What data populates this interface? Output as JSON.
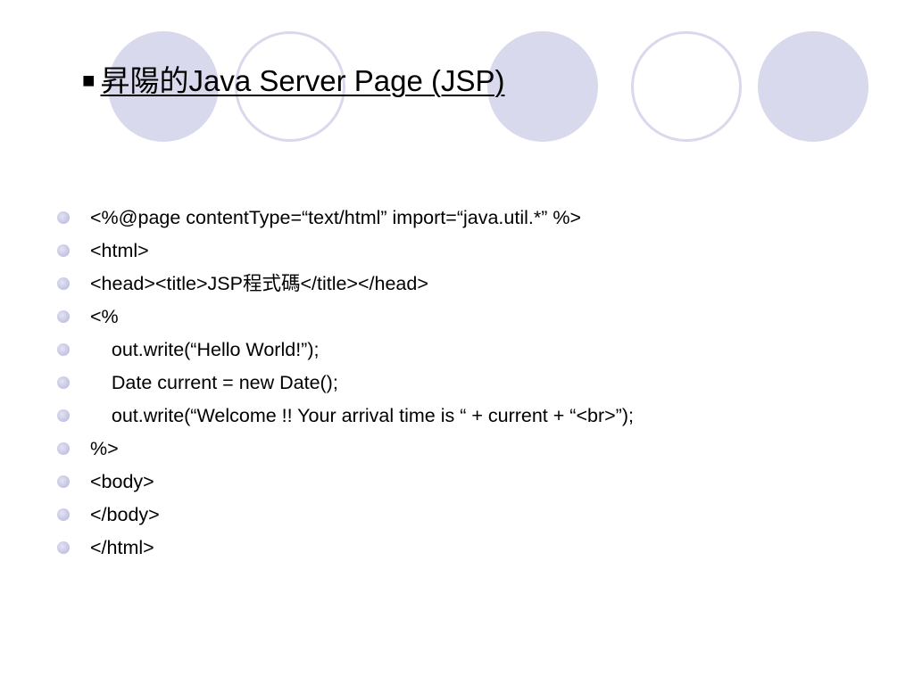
{
  "title": {
    "marker": "■",
    "text": "昇陽的Java Server Page (JSP)"
  },
  "decoration": {
    "circle_fill_color": "#d9d9ee",
    "bullet_color": "#c6c6e6"
  },
  "bullets": [
    "<%@page contentType=“text/html” import=“java.util.*” %>",
    "<html>",
    "<head><title>JSP程式碼</title></head>",
    "<%",
    "    out.write(“Hello World!”);",
    "    Date current = new Date();",
    "    out.write(“Welcome !! Your arrival time is “ + current + “<br>”);",
    "%>",
    "<body>",
    "</body>",
    "</html>"
  ]
}
